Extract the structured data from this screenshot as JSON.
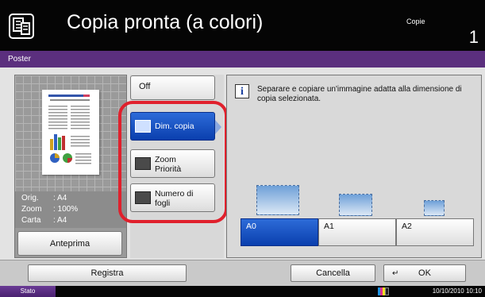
{
  "header": {
    "title": "Copia pronta (a colori)",
    "copies_label": "Copie",
    "copies_value": "1"
  },
  "section": {
    "title": "Poster"
  },
  "preview": {
    "orig_label": "Orig.",
    "orig_value": ": A4",
    "zoom_label": "Zoom",
    "zoom_value": ": 100%",
    "carta_label": "Carta",
    "carta_value": ": A4",
    "preview_button": "Anteprima"
  },
  "options": {
    "off": "Off",
    "dim_copia": "Dim. copia",
    "zoom_line1": "Zoom",
    "zoom_line2": "Priorità",
    "numero_line1": "Numero di",
    "numero_line2": "fogli",
    "selected": "Dim. copia"
  },
  "description": "Separare e copiare un'immagine adatta alla dimensione di copia selezionata.",
  "sizes": [
    {
      "label": "A0",
      "selected": true
    },
    {
      "label": "A1",
      "selected": false
    },
    {
      "label": "A2",
      "selected": false
    }
  ],
  "bottom": {
    "registra": "Registra",
    "cancella": "Cancella",
    "ok": "OK"
  },
  "status": {
    "stato": "Stato",
    "datetime": "10/10/2010  10:10"
  },
  "colors": {
    "purple": "#5b2f7e",
    "selected_blue": "#0a3fae",
    "highlight_red": "#e0202c"
  },
  "icons": [
    "document-copy-icon",
    "info-icon",
    "enter-icon",
    "toner-icon"
  ]
}
